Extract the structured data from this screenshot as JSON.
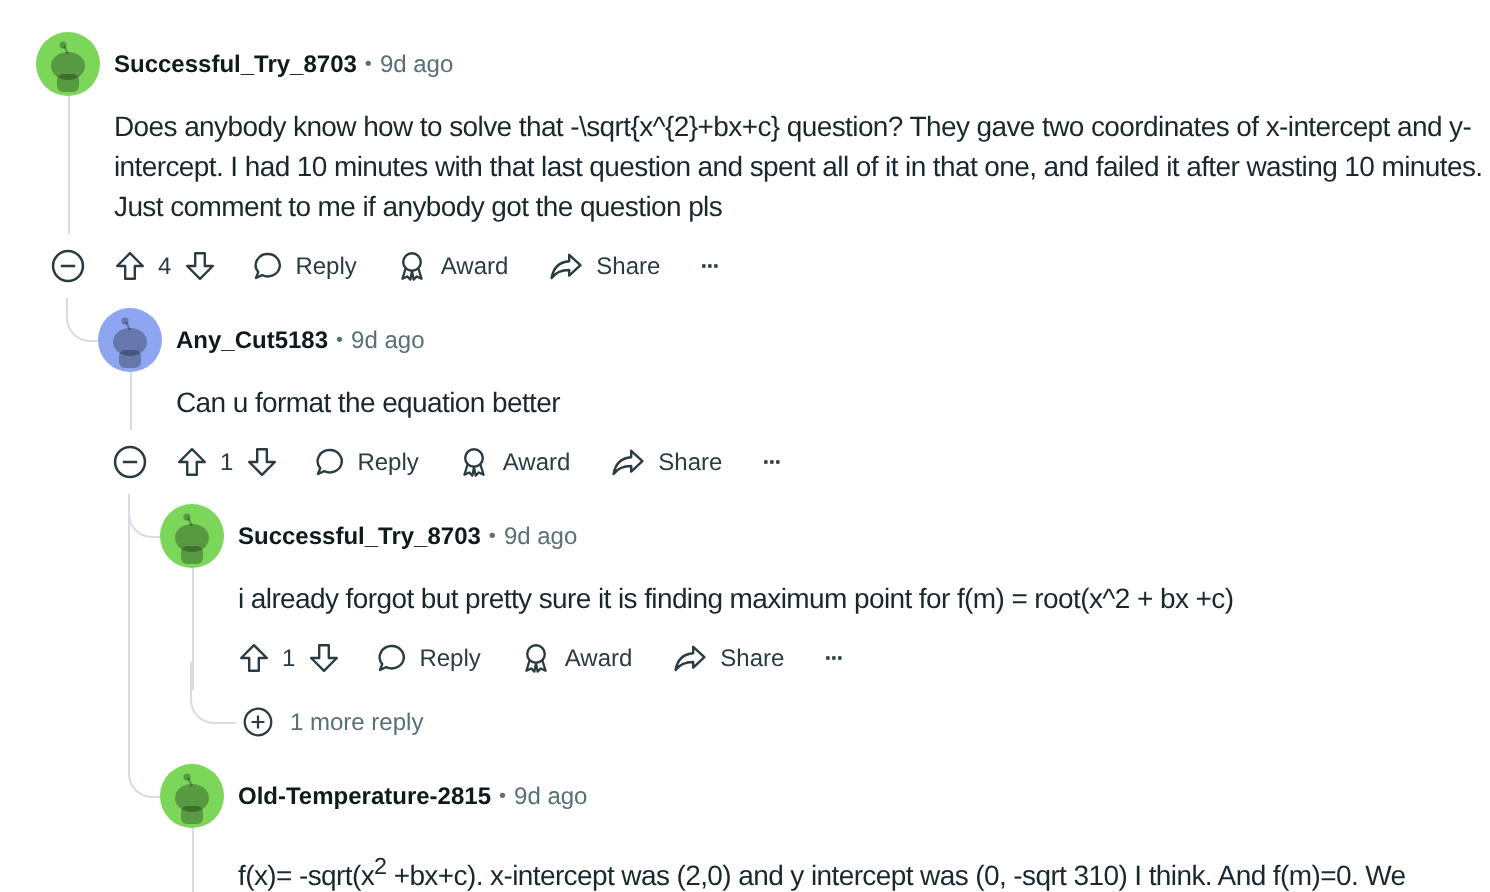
{
  "comments": [
    {
      "author": "Successful_Try_8703",
      "separator": "•",
      "time": "9d ago",
      "color": "#7bd65a",
      "body": "Does anybody know how to solve that -\\sqrt{x^{2}+bx+c} question? They gave two coordinates of x-intercept and y-intercept. I had 10 minutes with that last question and spent all of it in that one, and failed it after wasting 10 minutes. Just comment to me if anybody got the question pls",
      "expanded": true,
      "actions": {
        "votes": "4",
        "reply": "Reply",
        "award": "Award",
        "share": "Share",
        "more": "···"
      },
      "children": [
        {
          "author": "Any_Cut5183",
          "separator": "•",
          "time": "9d ago",
          "color": "#8ea6f2",
          "body": "Can u format the equation better",
          "expanded": true,
          "actions": {
            "votes": "1",
            "reply": "Reply",
            "award": "Award",
            "share": "Share",
            "more": "···"
          },
          "children": [
            {
              "author": "Successful_Try_8703",
              "separator": "•",
              "time": "9d ago",
              "color": "#7bd65a",
              "body": "i already forgot but pretty sure it is finding maximum point for f(m) = root(x^2 + bx +c)",
              "actions": {
                "votes": "1",
                "reply": "Reply",
                "award": "Award",
                "share": "Share",
                "more": "···"
              },
              "more_replies": "1 more reply"
            },
            {
              "author": "Old-Temperature-2815",
              "separator": "•",
              "time": "9d ago",
              "color": "#7bd65a",
              "body": "f(x)= -sqrt(x$^{2}$ +bx+c). x-intercept was (2,0) and y intercept was (0, -sqrt 310) I think. And f(m)=0. We"
            }
          ]
        }
      ]
    }
  ]
}
